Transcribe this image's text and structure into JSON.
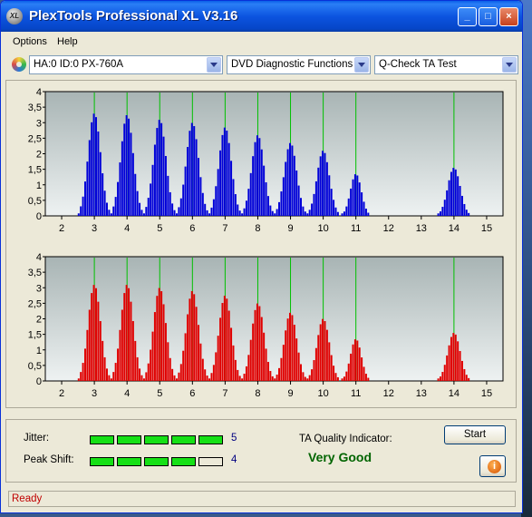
{
  "window": {
    "title": "PlexTools Professional XL V3.16",
    "icon_text": "XL",
    "controls": {
      "minimize": "_",
      "maximize": "□",
      "close": "×"
    }
  },
  "menu": {
    "items": [
      "Options",
      "Help"
    ]
  },
  "toolbar": {
    "drive": "HA:0 ID:0  PX-760A",
    "function": "DVD Diagnostic Functions",
    "test": "Q-Check TA Test"
  },
  "charts": {
    "y_ticks": [
      "4",
      "3,5",
      "3",
      "2,5",
      "2",
      "1,5",
      "1",
      "0,5",
      "0"
    ],
    "x_ticks": [
      "2",
      "3",
      "4",
      "5",
      "6",
      "7",
      "8",
      "9",
      "10",
      "11",
      "12",
      "13",
      "14",
      "15"
    ],
    "marker_positions": [
      3,
      4,
      5,
      6,
      7,
      8,
      9,
      10,
      11,
      14
    ],
    "colors": {
      "top": "#0000d8",
      "bottom": "#e00000",
      "marker": "#00c000"
    }
  },
  "chart_data": [
    {
      "type": "bar",
      "name": "upper",
      "peaks": [
        {
          "center": 3,
          "height": 3.3
        },
        {
          "center": 4,
          "height": 3.25
        },
        {
          "center": 5,
          "height": 3.1
        },
        {
          "center": 6,
          "height": 3.0
        },
        {
          "center": 7,
          "height": 2.85
        },
        {
          "center": 8,
          "height": 2.6
        },
        {
          "center": 9,
          "height": 2.35
        },
        {
          "center": 10,
          "height": 2.1
        },
        {
          "center": 11,
          "height": 1.35
        },
        {
          "center": 14,
          "height": 1.55
        }
      ],
      "xlim": [
        1.5,
        15.5
      ],
      "ylim": [
        0,
        4
      ]
    },
    {
      "type": "bar",
      "name": "lower",
      "peaks": [
        {
          "center": 3,
          "height": 3.1
        },
        {
          "center": 4,
          "height": 3.1
        },
        {
          "center": 5,
          "height": 3.0
        },
        {
          "center": 6,
          "height": 2.9
        },
        {
          "center": 7,
          "height": 2.75
        },
        {
          "center": 8,
          "height": 2.5
        },
        {
          "center": 9,
          "height": 2.2
        },
        {
          "center": 10,
          "height": 2.0
        },
        {
          "center": 11,
          "height": 1.35
        },
        {
          "center": 14,
          "height": 1.55
        }
      ],
      "xlim": [
        1.5,
        15.5
      ],
      "ylim": [
        0,
        4
      ]
    }
  ],
  "results": {
    "jitter_label": "Jitter:",
    "jitter_value": "5",
    "jitter_level": 5,
    "peak_label": "Peak Shift:",
    "peak_value": "4",
    "peak_level": 4,
    "tqi_label": "TA Quality Indicator:",
    "tqi_value": "Very Good",
    "start_label": "Start",
    "info_icon_text": "i"
  },
  "status": {
    "text": "Ready"
  }
}
